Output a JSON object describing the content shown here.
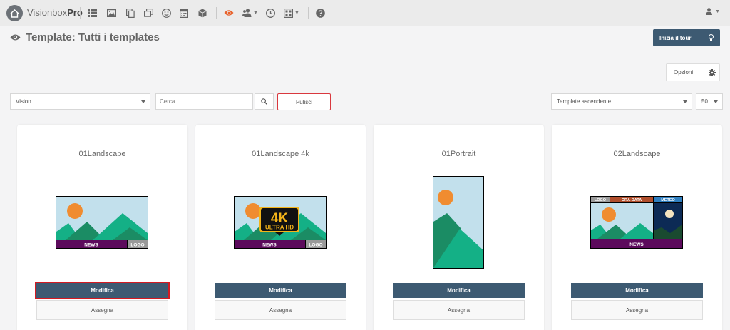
{
  "app": {
    "brand_light": "Visionbox",
    "brand_bold": "Pro"
  },
  "page": {
    "title": "Template: Tutti i templates"
  },
  "header": {
    "tour_label": "Inizia il tour",
    "options_label": "Opzioni"
  },
  "filters": {
    "vision_value": "Vision",
    "search_placeholder": "Cerca",
    "clear_label": "Pulisci",
    "sort_value": "Template ascendente",
    "page_size_value": "50"
  },
  "template_labels": {
    "news": "NEWS",
    "logo": "LOGO",
    "ora_data": "ORA-DATA",
    "meteo": "METEO",
    "fourk": "4K",
    "ultra_hd": "ULTRA HD"
  },
  "cards": [
    {
      "title": "01Landscape",
      "edit_label": "Modifica",
      "assign_label": "Assegna"
    },
    {
      "title": "01Landscape 4k",
      "edit_label": "Modifica",
      "assign_label": "Assegna"
    },
    {
      "title": "01Portrait",
      "edit_label": "Modifica",
      "assign_label": "Assegna"
    },
    {
      "title": "02Landscape",
      "edit_label": "Modifica",
      "assign_label": "Assegna"
    }
  ],
  "colors": {
    "primary": "#3d5a72",
    "highlight": "#d31b22",
    "accent_eye": "#e8622c",
    "sky": "#c2e0ec",
    "sun": "#f08c30",
    "mountain_dark": "#1b8c64",
    "mountain_light": "#14b086",
    "news_bar": "#5c0a5c",
    "logo_box": "#9a9a9a"
  }
}
